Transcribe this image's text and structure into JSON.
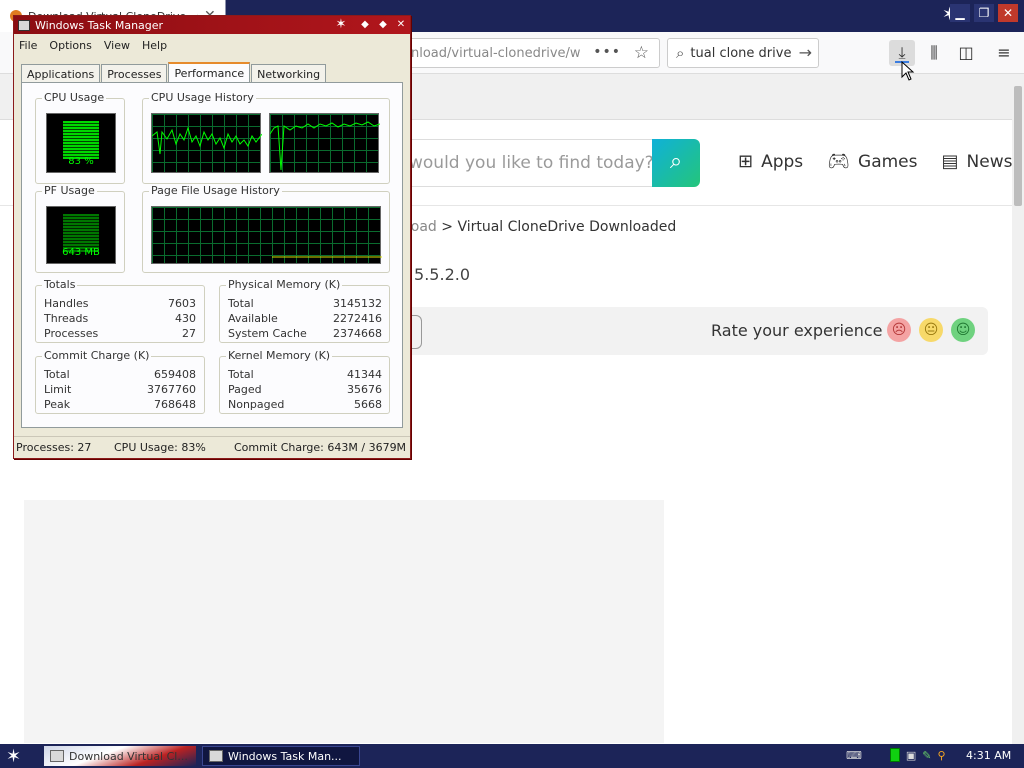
{
  "browser": {
    "tab_title": "Download Virtual CloneDrive - Softonic",
    "url_partial": "nload/virtual-clonedrive/w",
    "search_query": "tual clone drive",
    "site_search_placeholder": "would you like to find today?",
    "nav_links": [
      {
        "label": "Apps",
        "icon": "apps-grid-icon"
      },
      {
        "label": "Games",
        "icon": "gamepad-icon"
      },
      {
        "label": "News",
        "icon": "news-icon"
      }
    ],
    "breadcrumb_prev": "nload",
    "breadcrumb_sep": ">",
    "breadcrumb_current": "Virtual CloneDrive Downloaded",
    "version_text": "V 5.5.2.0",
    "rate_label": "Rate your experience"
  },
  "taskmanager": {
    "title": "Windows Task Manager",
    "menu": [
      "File",
      "Options",
      "View",
      "Help"
    ],
    "tabs": [
      "Applications",
      "Processes",
      "Performance",
      "Networking"
    ],
    "active_tab": "Performance",
    "cpu_usage_label": "CPU Usage",
    "cpu_usage_value": "83 %",
    "cpu_history_label": "CPU Usage History",
    "pf_usage_label": "PF Usage",
    "pf_usage_value": "643 MB",
    "pf_history_label": "Page File Usage History",
    "totals": {
      "label": "Totals",
      "rows": [
        {
          "k": "Handles",
          "v": "7603"
        },
        {
          "k": "Threads",
          "v": "430"
        },
        {
          "k": "Processes",
          "v": "27"
        }
      ]
    },
    "physical_memory": {
      "label": "Physical Memory (K)",
      "rows": [
        {
          "k": "Total",
          "v": "3145132"
        },
        {
          "k": "Available",
          "v": "2272416"
        },
        {
          "k": "System Cache",
          "v": "2374668"
        }
      ]
    },
    "commit_charge": {
      "label": "Commit Charge (K)",
      "rows": [
        {
          "k": "Total",
          "v": "659408"
        },
        {
          "k": "Limit",
          "v": "3767760"
        },
        {
          "k": "Peak",
          "v": "768648"
        }
      ]
    },
    "kernel_memory": {
      "label": "Kernel Memory (K)",
      "rows": [
        {
          "k": "Total",
          "v": "41344"
        },
        {
          "k": "Paged",
          "v": "35676"
        },
        {
          "k": "Nonpaged",
          "v": "5668"
        }
      ]
    },
    "status": {
      "processes": "Processes: 27",
      "cpu": "CPU Usage: 83%",
      "commit": "Commit Charge: 643M / 3679M"
    }
  },
  "taskbar": {
    "items": [
      "Download Virtual Cl...",
      "Windows Task Man..."
    ],
    "clock": "4:31 AM"
  },
  "colors": {
    "taskbar": "#1c2458",
    "tm_title": "#b1161c",
    "graph_line": "#00ff00",
    "search_btn": "#24c57a"
  }
}
